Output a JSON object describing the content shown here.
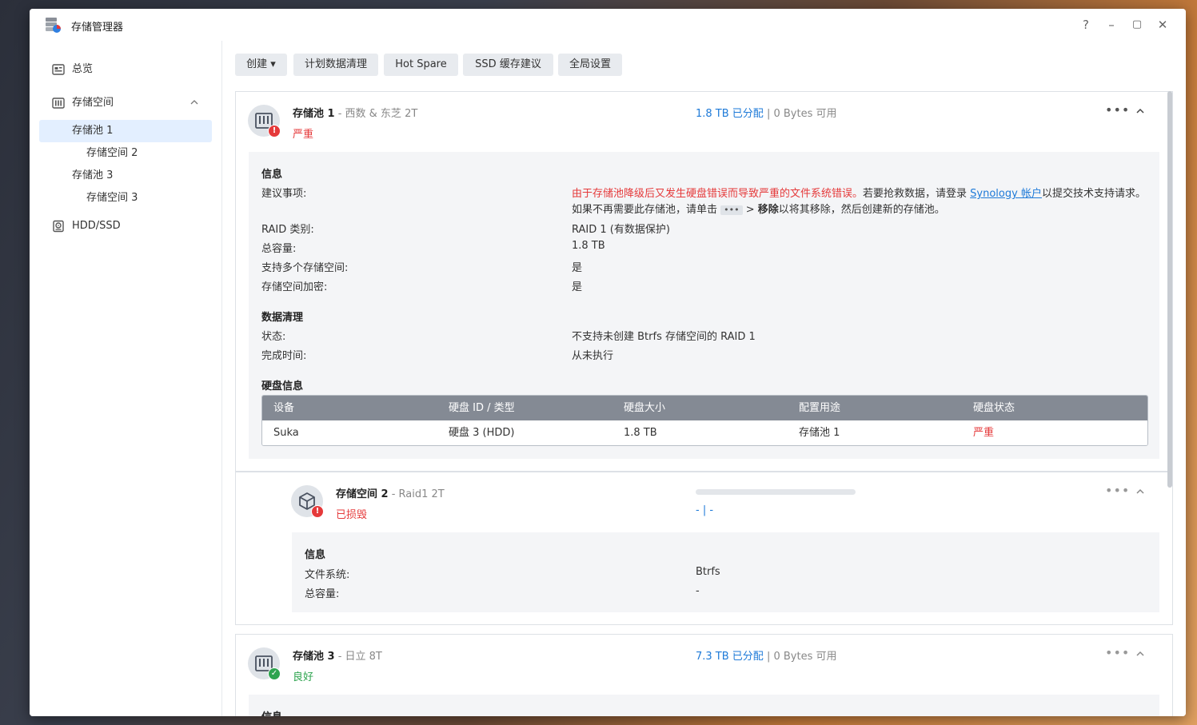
{
  "app": {
    "title": "存储管理器"
  },
  "window_controls": {
    "help": "?",
    "minimize": "–",
    "maximize": "▢",
    "close": "✕"
  },
  "sidebar": {
    "items": [
      {
        "label": "总览"
      },
      {
        "label": "存储空间"
      },
      {
        "label": "存储池 1"
      },
      {
        "label": "存储空间 2"
      },
      {
        "label": "存储池 3"
      },
      {
        "label": "存储空间 3"
      },
      {
        "label": "HDD/SSD"
      }
    ]
  },
  "toolbar": {
    "create": "创建 ▾",
    "scrub": "计划数据清理",
    "hotspare": "Hot Spare",
    "ssd": "SSD 缓存建议",
    "global": "全局设置"
  },
  "pool1": {
    "name": "存储池 1",
    "desc": " - 西数 & 东芝 2T",
    "status": "严重",
    "allocated": "1.8 TB 已分配",
    "sep": " | ",
    "available": "0 Bytes 可用",
    "more": "•••",
    "info": {
      "title": "信息",
      "advice_label": "建议事项:",
      "advice_red": "由于存储池降级后又发生硬盘错误而导致严重的文件系统错误。",
      "advice_mid": "若要抢救数据，请登录 ",
      "advice_link": "Synology 帐户",
      "advice_end": "以提交技术支持请求。",
      "advice_line2a": "如果不再需要此存储池，请单击 ",
      "advice_chip": "•••",
      "advice_line2b": " > ",
      "advice_remove": "移除",
      "advice_line2c": "以将其移除，然后创建新的存储池。",
      "raid_label": "RAID 类别:",
      "raid_value": "RAID 1 (有数据保护)",
      "capacity_label": "总容量:",
      "capacity_value": "1.8 TB",
      "multi_label": "支持多个存储空间:",
      "multi_value": "是",
      "encrypt_label": "存储空间加密:",
      "encrypt_value": "是"
    },
    "scrubbing": {
      "title": "数据清理",
      "state_label": "状态:",
      "state_value": "不支持未创建 Btrfs 存储空间的 RAID 1",
      "done_label": "完成时间:",
      "done_value": "从未执行"
    },
    "disks": {
      "title": "硬盘信息",
      "headers": [
        "设备",
        "硬盘 ID / 类型",
        "硬盘大小",
        "配置用途",
        "硬盘状态"
      ],
      "rows": [
        {
          "device": "Suka",
          "id": "硬盘 3 (HDD)",
          "size": "1.8 TB",
          "usage": "存储池 1",
          "status": "严重"
        }
      ]
    }
  },
  "volume2": {
    "name": "存储空间 2",
    "desc": " - Raid1 2T",
    "status": "已损毁",
    "cap": "- | -",
    "more": "•••",
    "info": {
      "title": "信息",
      "fs_label": "文件系统:",
      "fs_value": "Btrfs",
      "capacity_label": "总容量:",
      "capacity_value": "-"
    }
  },
  "pool3": {
    "name": "存储池 3",
    "desc": " - 日立 8T",
    "status": "良好",
    "allocated": "7.3 TB 已分配",
    "sep": " | ",
    "available": "0 Bytes 可用",
    "more": "•••",
    "info_title": "信息"
  },
  "colors": {
    "accent": "#1e7ad8",
    "danger": "#e5393a",
    "ok": "#2ea44f"
  }
}
